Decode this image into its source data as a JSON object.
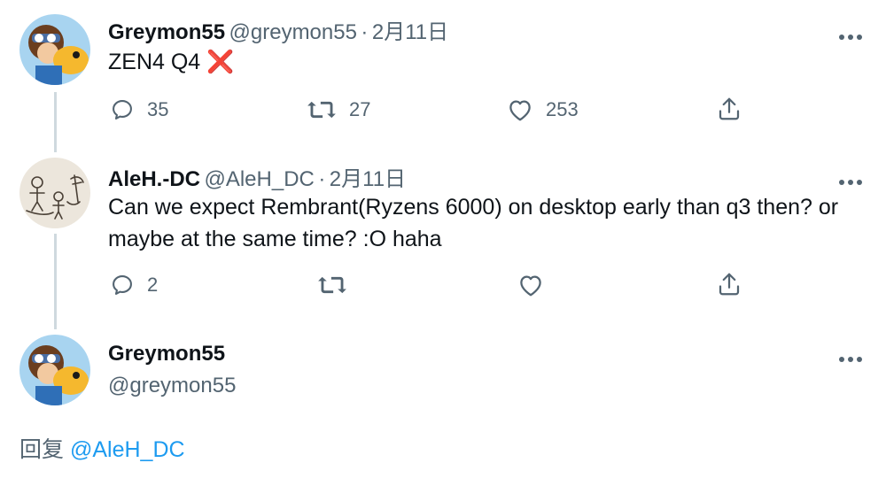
{
  "tweet1": {
    "name": "Greymon55",
    "handle": "@greymon55",
    "sep": "·",
    "date": "2月11日",
    "text": "ZEN4 Q4",
    "emoji": "❌",
    "replies": "35",
    "retweets": "27",
    "likes": "253"
  },
  "tweet2": {
    "name": "AleH.-DC",
    "handle": "@AleH_DC",
    "sep": "·",
    "date": "2月11日",
    "text": "Can we expect Rembrant(Ryzens 6000) on desktop early than q3 then? or maybe at the same time? :O haha",
    "replies": "2"
  },
  "tweet3": {
    "name": "Greymon55",
    "handle": "@greymon55",
    "reply_prefix": "回复",
    "reply_to": "@AleH_DC"
  },
  "icons": {
    "more": "more-icon",
    "reply": "reply-icon",
    "retweet": "retweet-icon",
    "like": "like-icon",
    "share": "share-icon"
  },
  "colors": {
    "text": "#0f1419",
    "secondary": "#536471",
    "accent": "#1d9bf0",
    "thread_line": "#cfd9de",
    "cross": "#e0245e"
  }
}
